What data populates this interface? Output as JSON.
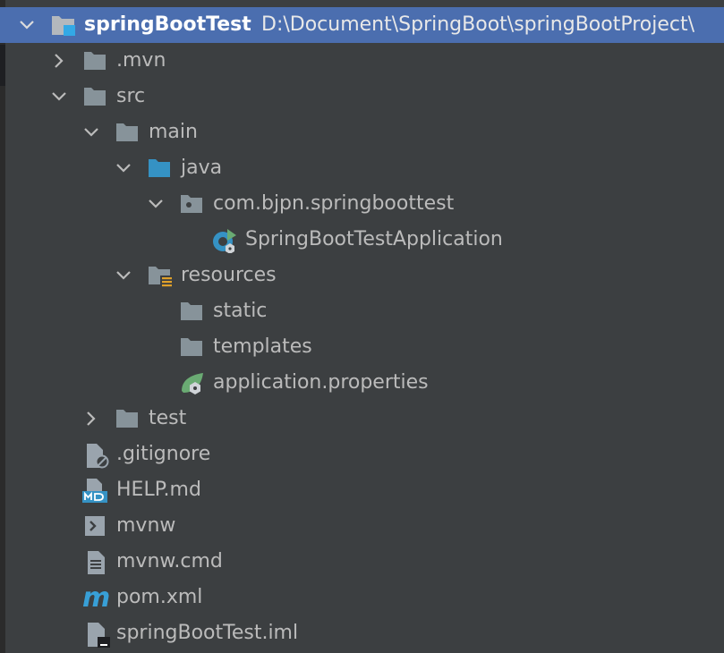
{
  "colors": {
    "panel_bg": "#3c3f41",
    "selection": "#4b6eaf",
    "text": "#bbbbbb",
    "folder": "#87939a",
    "source_folder": "#3592c4",
    "resource_bar": "#e0a12a",
    "spring_green": "#6aab73",
    "maven_blue": "#389fd6"
  },
  "tree": {
    "root": {
      "name": "springBootTest",
      "path": "D:\\Document\\SpringBoot\\springBootProject\\",
      "icon": "module-folder-icon",
      "expanded": true
    },
    "items": [
      {
        "name": ".mvn",
        "icon": "folder-icon",
        "expanded": false
      },
      {
        "name": "src",
        "icon": "folder-icon",
        "expanded": true
      },
      {
        "name": "main",
        "icon": "folder-icon",
        "expanded": true
      },
      {
        "name": "java",
        "icon": "source-folder-icon",
        "expanded": true
      },
      {
        "name": "com.bjpn.springboottest",
        "icon": "package-icon",
        "expanded": true
      },
      {
        "name": "SpringBootTestApplication",
        "icon": "spring-boot-app-icon"
      },
      {
        "name": "resources",
        "icon": "resources-folder-icon",
        "expanded": true
      },
      {
        "name": "static",
        "icon": "folder-icon"
      },
      {
        "name": "templates",
        "icon": "folder-icon"
      },
      {
        "name": "application.properties",
        "icon": "spring-properties-icon"
      },
      {
        "name": "test",
        "icon": "folder-icon",
        "expanded": false
      },
      {
        "name": ".gitignore",
        "icon": "gitignore-file-icon"
      },
      {
        "name": "HELP.md",
        "icon": "markdown-file-icon"
      },
      {
        "name": "mvnw",
        "icon": "shell-script-icon"
      },
      {
        "name": "mvnw.cmd",
        "icon": "text-file-icon"
      },
      {
        "name": "pom.xml",
        "icon": "maven-icon"
      },
      {
        "name": "springBootTest.iml",
        "icon": "iml-file-icon"
      }
    ]
  }
}
